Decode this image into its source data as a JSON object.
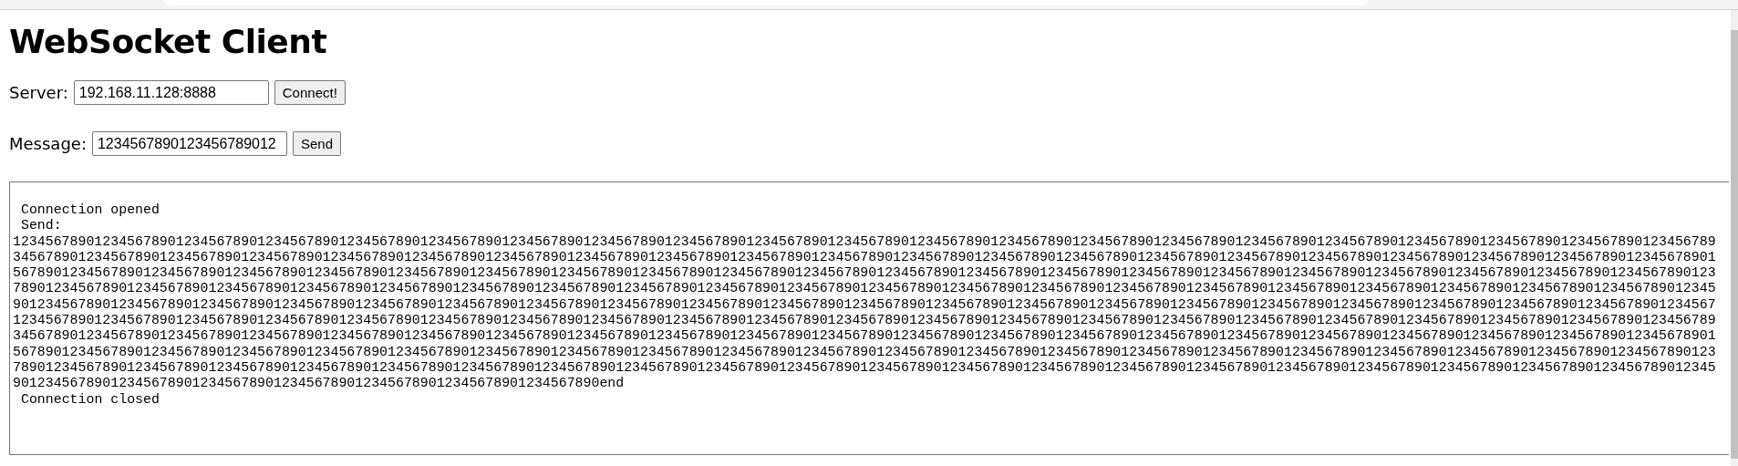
{
  "title": "WebSocket Client",
  "server": {
    "label": "Server:",
    "value": "192.168.11.128:8888",
    "button": "Connect!"
  },
  "message": {
    "label": "Message:",
    "value": "1234567890123456789012",
    "button": "Send"
  },
  "log": [
    {
      "kind": "status",
      "text": "Connection opened"
    },
    {
      "kind": "status",
      "text": "Send:"
    },
    {
      "kind": "data",
      "text": "12345678901234567890123456789012345678901234567890123456789012345678901234567890123456789012345678901234567890123456789012345678901234567890123456789012345678901234567890123456789012345678901234567890123456789"
    },
    {
      "kind": "data",
      "text": "34567890123456789012345678901234567890123456789012345678901234567890123456789012345678901234567890123456789012345678901234567890123456789012345678901234567890123456789012345678901234567890123456789012345678901"
    },
    {
      "kind": "data",
      "text": "56789012345678901234567890123456789012345678901234567890123456789012345678901234567890123456789012345678901234567890123456789012345678901234567890123456789012345678901234567890123456789012345678901234567890123"
    },
    {
      "kind": "data",
      "text": "78901234567890123456789012345678901234567890123456789012345678901234567890123456789012345678901234567890123456789012345678901234567890123456789012345678901234567890123456789012345678901234567890123456789012345"
    },
    {
      "kind": "data",
      "text": "90123456789012345678901234567890123456789012345678901234567890123456789012345678901234567890123456789012345678901234567890123456789012345678901234567890123456789012345678901234567890123456789012345678901234567"
    },
    {
      "kind": "data",
      "text": "12345678901234567890123456789012345678901234567890123456789012345678901234567890123456789012345678901234567890123456789012345678901234567890123456789012345678901234567890123456789012345678901234567890123456789"
    },
    {
      "kind": "data",
      "text": "34567890123456789012345678901234567890123456789012345678901234567890123456789012345678901234567890123456789012345678901234567890123456789012345678901234567890123456789012345678901234567890123456789012345678901"
    },
    {
      "kind": "data",
      "text": "56789012345678901234567890123456789012345678901234567890123456789012345678901234567890123456789012345678901234567890123456789012345678901234567890123456789012345678901234567890123456789012345678901234567890123"
    },
    {
      "kind": "data",
      "text": "78901234567890123456789012345678901234567890123456789012345678901234567890123456789012345678901234567890123456789012345678901234567890123456789012345678901234567890123456789012345678901234567890123456789012345"
    },
    {
      "kind": "data",
      "text": "901234567890123456789012345678901234567890123456789012345678901234567890end"
    },
    {
      "kind": "status",
      "text": "Connection closed"
    }
  ]
}
